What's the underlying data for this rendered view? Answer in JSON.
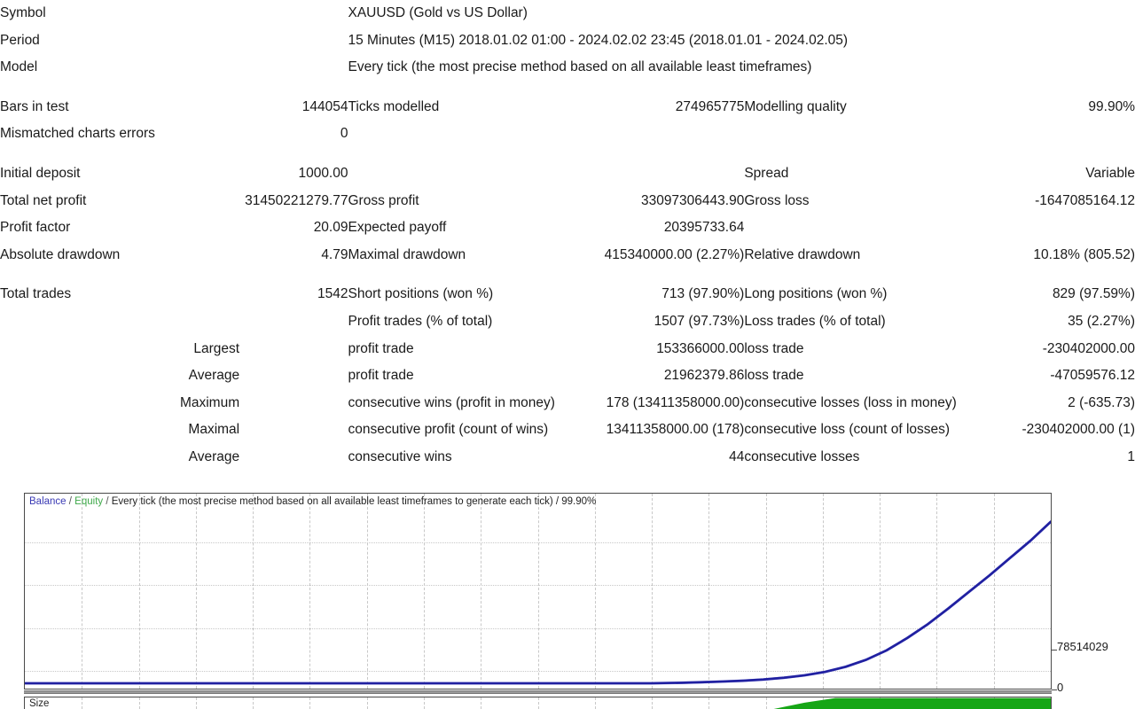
{
  "header": {
    "symbol_label": "Symbol",
    "symbol_value": "XAUUSD (Gold vs US Dollar)",
    "period_label": "Period",
    "period_value": "15 Minutes (M15) 2018.01.02 01:00 - 2024.02.02 23:45 (2018.01.01 - 2024.02.05)",
    "model_label": "Model",
    "model_value": "Every tick (the most precise method based on all available least timeframes)"
  },
  "stats": {
    "bars_in_test_label": "Bars in test",
    "bars_in_test_value": "144054",
    "ticks_modelled_label": "Ticks modelled",
    "ticks_modelled_value": "274965775",
    "modelling_quality_label": "Modelling quality",
    "modelling_quality_value": "99.90%",
    "mismatched_label": "Mismatched charts errors",
    "mismatched_value": "0",
    "initial_deposit_label": "Initial deposit",
    "initial_deposit_value": "1000.00",
    "spread_label": "Spread",
    "spread_value": "Variable",
    "total_net_profit_label": "Total net profit",
    "total_net_profit_value": "31450221279.77",
    "gross_profit_label": "Gross profit",
    "gross_profit_value": "33097306443.90",
    "gross_loss_label": "Gross loss",
    "gross_loss_value": "-1647085164.12",
    "profit_factor_label": "Profit factor",
    "profit_factor_value": "20.09",
    "expected_payoff_label": "Expected payoff",
    "expected_payoff_value": "20395733.64",
    "absolute_drawdown_label": "Absolute drawdown",
    "absolute_drawdown_value": "4.79",
    "maximal_drawdown_label": "Maximal drawdown",
    "maximal_drawdown_value": "415340000.00 (2.27%)",
    "relative_drawdown_label": "Relative drawdown",
    "relative_drawdown_value": "10.18% (805.52)",
    "total_trades_label": "Total trades",
    "total_trades_value": "1542",
    "short_positions_label": "Short positions (won %)",
    "short_positions_value": "713 (97.90%)",
    "long_positions_label": "Long positions (won %)",
    "long_positions_value": "829 (97.59%)",
    "profit_trades_label": "Profit trades (% of total)",
    "profit_trades_value": "1507 (97.73%)",
    "loss_trades_label": "Loss trades (% of total)",
    "loss_trades_value": "35 (2.27%)",
    "largest_label": "Largest",
    "largest_profit_trade_label": "profit trade",
    "largest_profit_trade_value": "153366000.00",
    "largest_loss_trade_label": "loss trade",
    "largest_loss_trade_value": "-230402000.00",
    "average_label": "Average",
    "average_profit_trade_label": "profit trade",
    "average_profit_trade_value": "21962379.86",
    "average_loss_trade_label": "loss trade",
    "average_loss_trade_value": "-47059576.12",
    "maximum_label": "Maximum",
    "max_consecutive_wins_label": "consecutive wins (profit in money)",
    "max_consecutive_wins_value": "178 (13411358000.00)",
    "max_consecutive_losses_label": "consecutive losses (loss in money)",
    "max_consecutive_losses_value": "2 (-635.73)",
    "maximal_label": "Maximal",
    "maximal_consecutive_profit_label": "consecutive profit (count of wins)",
    "maximal_consecutive_profit_value": "13411358000.00 (178)",
    "maximal_consecutive_loss_label": "consecutive loss (count of losses)",
    "maximal_consecutive_loss_value": "-230402000.00 (1)",
    "average2_label": "Average",
    "avg_consecutive_wins_label": "consecutive wins",
    "avg_consecutive_wins_value": "44",
    "avg_consecutive_losses_label": "consecutive losses",
    "avg_consecutive_losses_value": "1"
  },
  "chart": {
    "legend_balance": "Balance",
    "legend_equity": "Equity",
    "legend_sep": "/",
    "legend_rest": "Every tick (the most precise method based on all available least timeframes to generate each tick) / 99.90%",
    "size_label": "Size",
    "axis_top_value": "78514029",
    "axis_bottom_value": "0",
    "balance_color": "#2020a0",
    "equity_color": "#8a8ae0",
    "size_color": "#16a616"
  },
  "chart_data": {
    "type": "line",
    "title": "Balance / Equity",
    "xlabel": "",
    "ylabel": "",
    "ylim": [
      0,
      78514029
    ],
    "yticks": [
      0,
      78514029
    ],
    "grid": true,
    "legend_position": "top-left",
    "series": [
      {
        "name": "Balance",
        "color": "#2020a0",
        "x": [
          0,
          5,
          10,
          15,
          20,
          25,
          30,
          35,
          40,
          45,
          50,
          55,
          58,
          61,
          64,
          66,
          68,
          70,
          72,
          74,
          76,
          78,
          80,
          82,
          84,
          86,
          88,
          90,
          92,
          94,
          96,
          98,
          100
        ],
        "y": [
          0,
          0,
          0,
          0,
          0,
          0,
          0,
          0,
          0,
          0,
          0,
          0,
          0,
          0,
          0.3,
          0.6,
          1.0,
          1.5,
          2.2,
          3.2,
          4.6,
          6.6,
          9.5,
          13.5,
          19.0,
          26.0,
          34.0,
          43.0,
          52.5,
          62.0,
          72.0,
          82.0,
          93.0
        ]
      },
      {
        "name": "Equity",
        "color": "#8a8ae0",
        "x": [
          0,
          5,
          10,
          15,
          20,
          25,
          30,
          35,
          40,
          45,
          50,
          55,
          58,
          61,
          64,
          66,
          68,
          70,
          72,
          74,
          76,
          78,
          80,
          82,
          84,
          86,
          88,
          90,
          92,
          94,
          96,
          98,
          100
        ],
        "y": [
          0,
          0,
          0,
          0,
          0,
          0,
          0,
          0,
          0,
          0,
          0,
          0,
          0,
          0,
          0.3,
          0.6,
          1.0,
          1.5,
          2.2,
          3.2,
          4.6,
          6.6,
          9.5,
          13.5,
          19.0,
          26.0,
          34.0,
          43.0,
          52.5,
          62.0,
          72.0,
          82.0,
          93.0
        ]
      }
    ],
    "subpanel": {
      "name": "Size",
      "type": "area",
      "color": "#16a616",
      "x": [
        0,
        73,
        76,
        79,
        100
      ],
      "y": [
        0,
        0,
        55,
        95,
        95
      ]
    }
  }
}
